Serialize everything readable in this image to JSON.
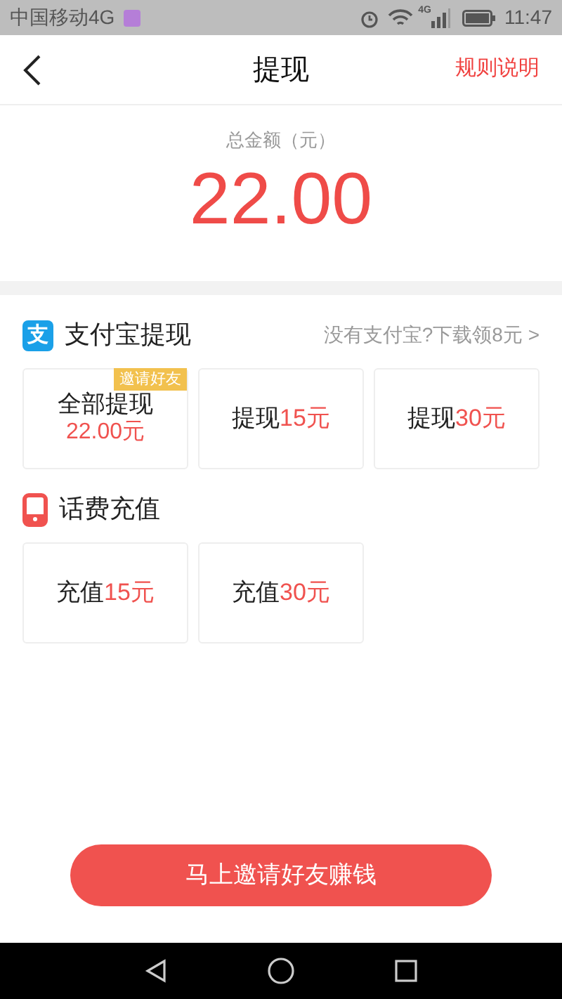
{
  "status_bar": {
    "carrier": "中国移动4G",
    "time": "11:47",
    "network": "4G"
  },
  "header": {
    "title": "提现",
    "action": "规则说明"
  },
  "balance": {
    "label": "总金额（元）",
    "amount": "22.00"
  },
  "sections": [
    {
      "kind": "alipay",
      "logo": "支",
      "title": "支付宝提现",
      "link": "没有支付宝?下载领8元 >",
      "options": [
        {
          "kind": "stacked",
          "label": "全部提现",
          "amount": "22.00元",
          "badge": "邀请好友"
        },
        {
          "kind": "inline",
          "label": "提现",
          "amount": "15元"
        },
        {
          "kind": "inline",
          "label": "提现",
          "amount": "30元"
        }
      ]
    },
    {
      "kind": "phone",
      "title": "话费充值",
      "options": [
        {
          "kind": "inline",
          "label": "充值",
          "amount": "15元"
        },
        {
          "kind": "inline",
          "label": "充值",
          "amount": "30元"
        }
      ]
    }
  ],
  "cta": "马上邀请好友赚钱"
}
